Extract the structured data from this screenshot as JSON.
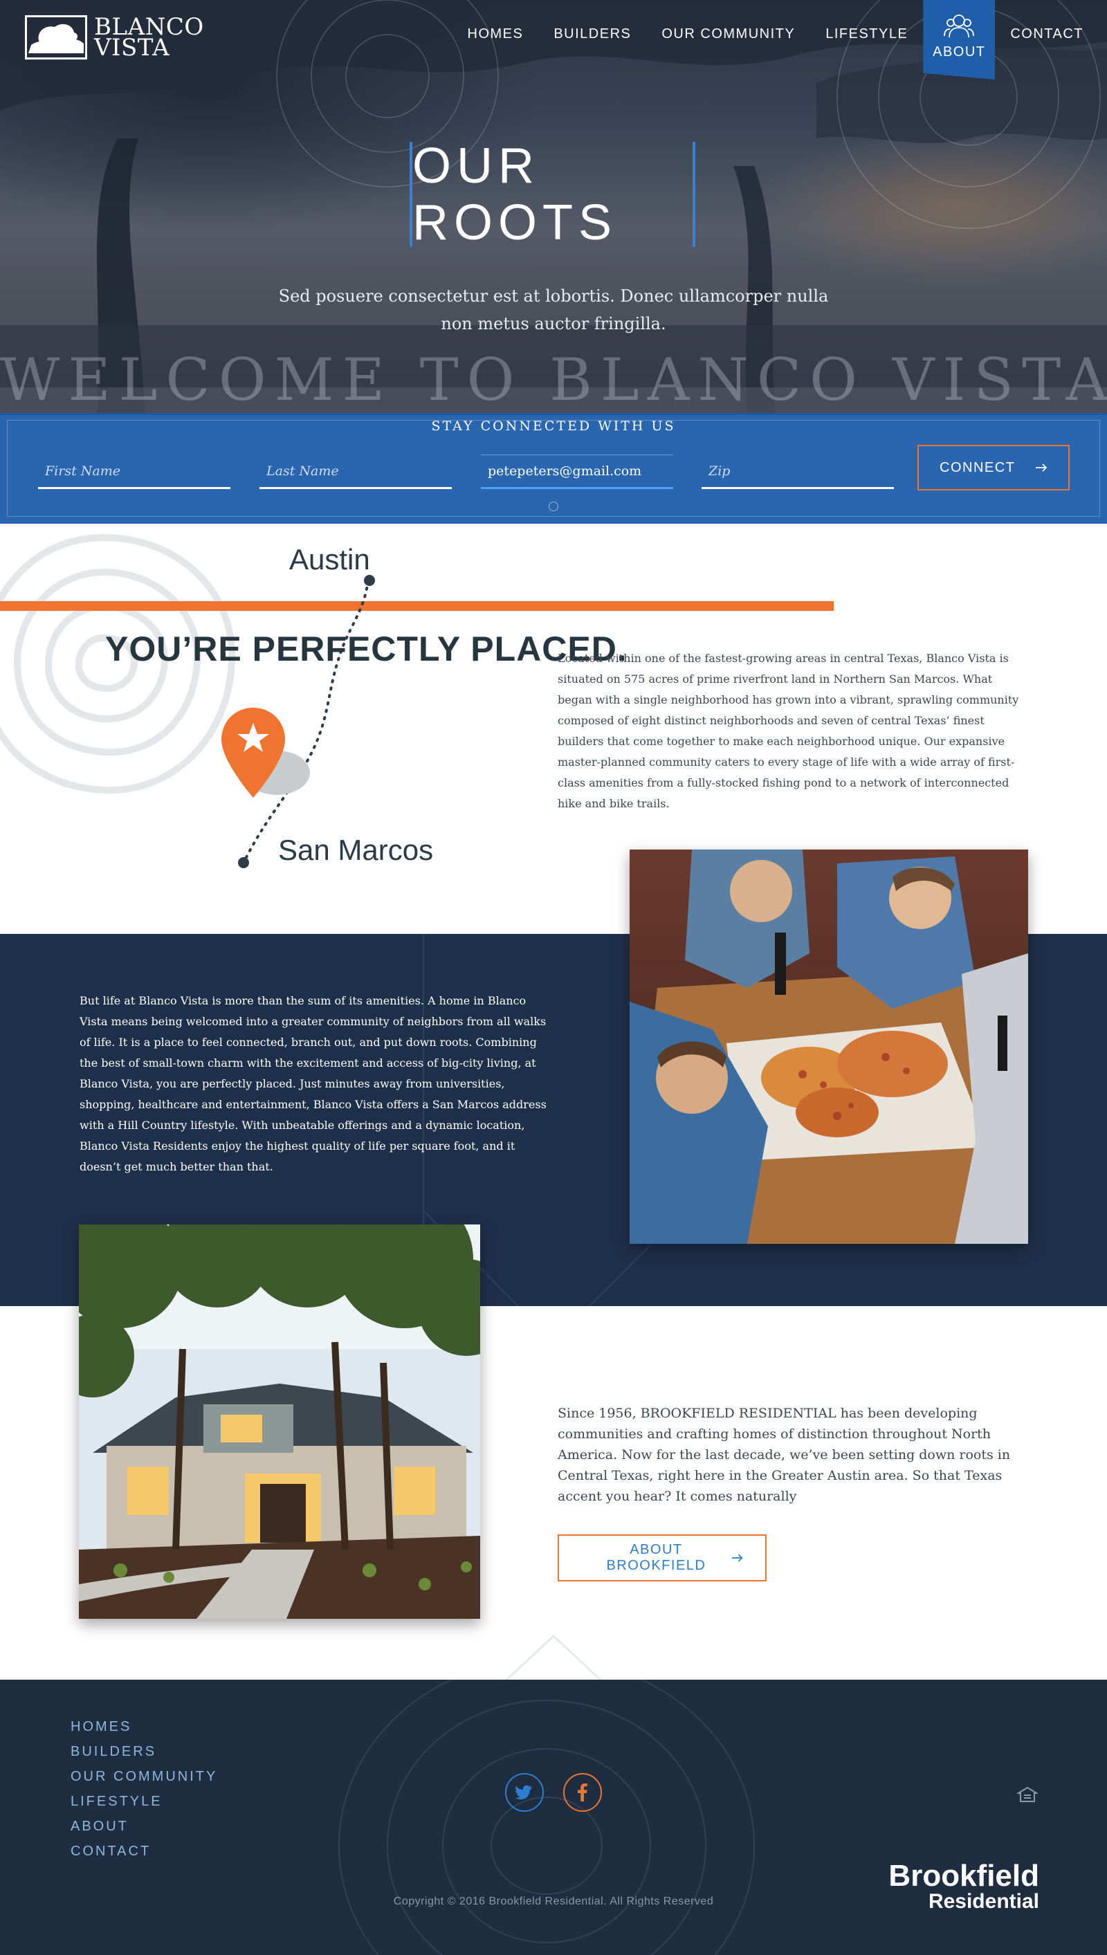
{
  "brand": {
    "logo_line1": "BLANCO",
    "logo_line2": "VISTA"
  },
  "nav": {
    "items": [
      {
        "label": "HOMES"
      },
      {
        "label": "BUILDERS"
      },
      {
        "label": "OUR COMMUNITY"
      },
      {
        "label": "LIFESTYLE"
      },
      {
        "label": "ABOUT",
        "active": true
      },
      {
        "label": "CONTACT"
      }
    ]
  },
  "hero": {
    "title": "OUR ROOTS",
    "subtitle": "Sed posuere consectetur est at lobortis. Donec ullamcorper nulla non metus auctor fringilla.",
    "welcome": "WELCOME TO BLANCO VISTA"
  },
  "connect": {
    "title": "STAY CONNECTED WITH US",
    "first_name_placeholder": "First Name",
    "last_name_placeholder": "Last Name",
    "email_value": "petepeters@gmail.com",
    "zip_placeholder": "Zip",
    "button_label": "CONNECT"
  },
  "place": {
    "city_top": "Austin",
    "city_bottom": "San Marcos",
    "title": "YOU’RE PERFECTLY PLACED.",
    "text": "Located within one of the fastest-growing areas in central Texas, Blanco Vista is situated on 575 acres of prime riverfront land in Northern San Marcos. What began with a single neighborhood has grown into a vibrant, sprawling community composed of eight distinct neighborhoods and seven of central Texas’ finest builders that come together to make each neighborhood unique. Our expansive master-planned community caters to every stage of life with a wide array of first-class amenities from a fully-stocked fishing pond to a network of interconnected hike and bike trails."
  },
  "life": {
    "text": "But life at Blanco Vista is more than the sum of its amenities. A home in Blanco Vista means being welcomed into a greater community of neighbors from all walks of life. It is a place to feel connected, branch out, and put down roots. Combining the best of small-town charm with the excitement and access of big-city living, at Blanco Vista, you are perfectly placed. Just minutes away from universities, shopping, healthcare and entertainment, Blanco Vista offers a San Marcos address with a Hill Country lifestyle. With unbeatable offerings and a dynamic location, Blanco Vista Residents enjoy the highest quality of life per square foot, and it doesn’t get much better than that."
  },
  "about": {
    "text": "Since 1956, BROOKFIELD RESIDENTIAL has been developing communities and crafting homes of distinction throughout North America. Now for the last decade, we’ve been setting down roots in Central Texas, right here in the Greater Austin area. So that Texas accent you hear? It comes naturally",
    "button_label": "ABOUT BROOKFIELD"
  },
  "footer": {
    "links": [
      {
        "label": "HOMES"
      },
      {
        "label": "BUILDERS"
      },
      {
        "label": "OUR COMMUNITY"
      },
      {
        "label": "LIFESTYLE"
      },
      {
        "label": "ABOUT"
      },
      {
        "label": "CONTACT"
      }
    ],
    "brand_line1": "Brookfield",
    "brand_line2": "Residential",
    "copyright": "Copyright © 2016 Brookfield Residential. All Rights Reserved"
  },
  "icons": {
    "logo": "tree-logo-icon",
    "about": "people-icon",
    "arrow": "arrow-right-icon",
    "map_pin": "star-map-pin-icon",
    "twitter": "twitter-icon",
    "facebook": "facebook-icon",
    "housing": "equal-housing-icon"
  },
  "colors": {
    "accent_orange": "#ef7430",
    "primary_blue": "#1f5ea8",
    "navy": "#1e3049",
    "text_dark": "#26363f"
  }
}
